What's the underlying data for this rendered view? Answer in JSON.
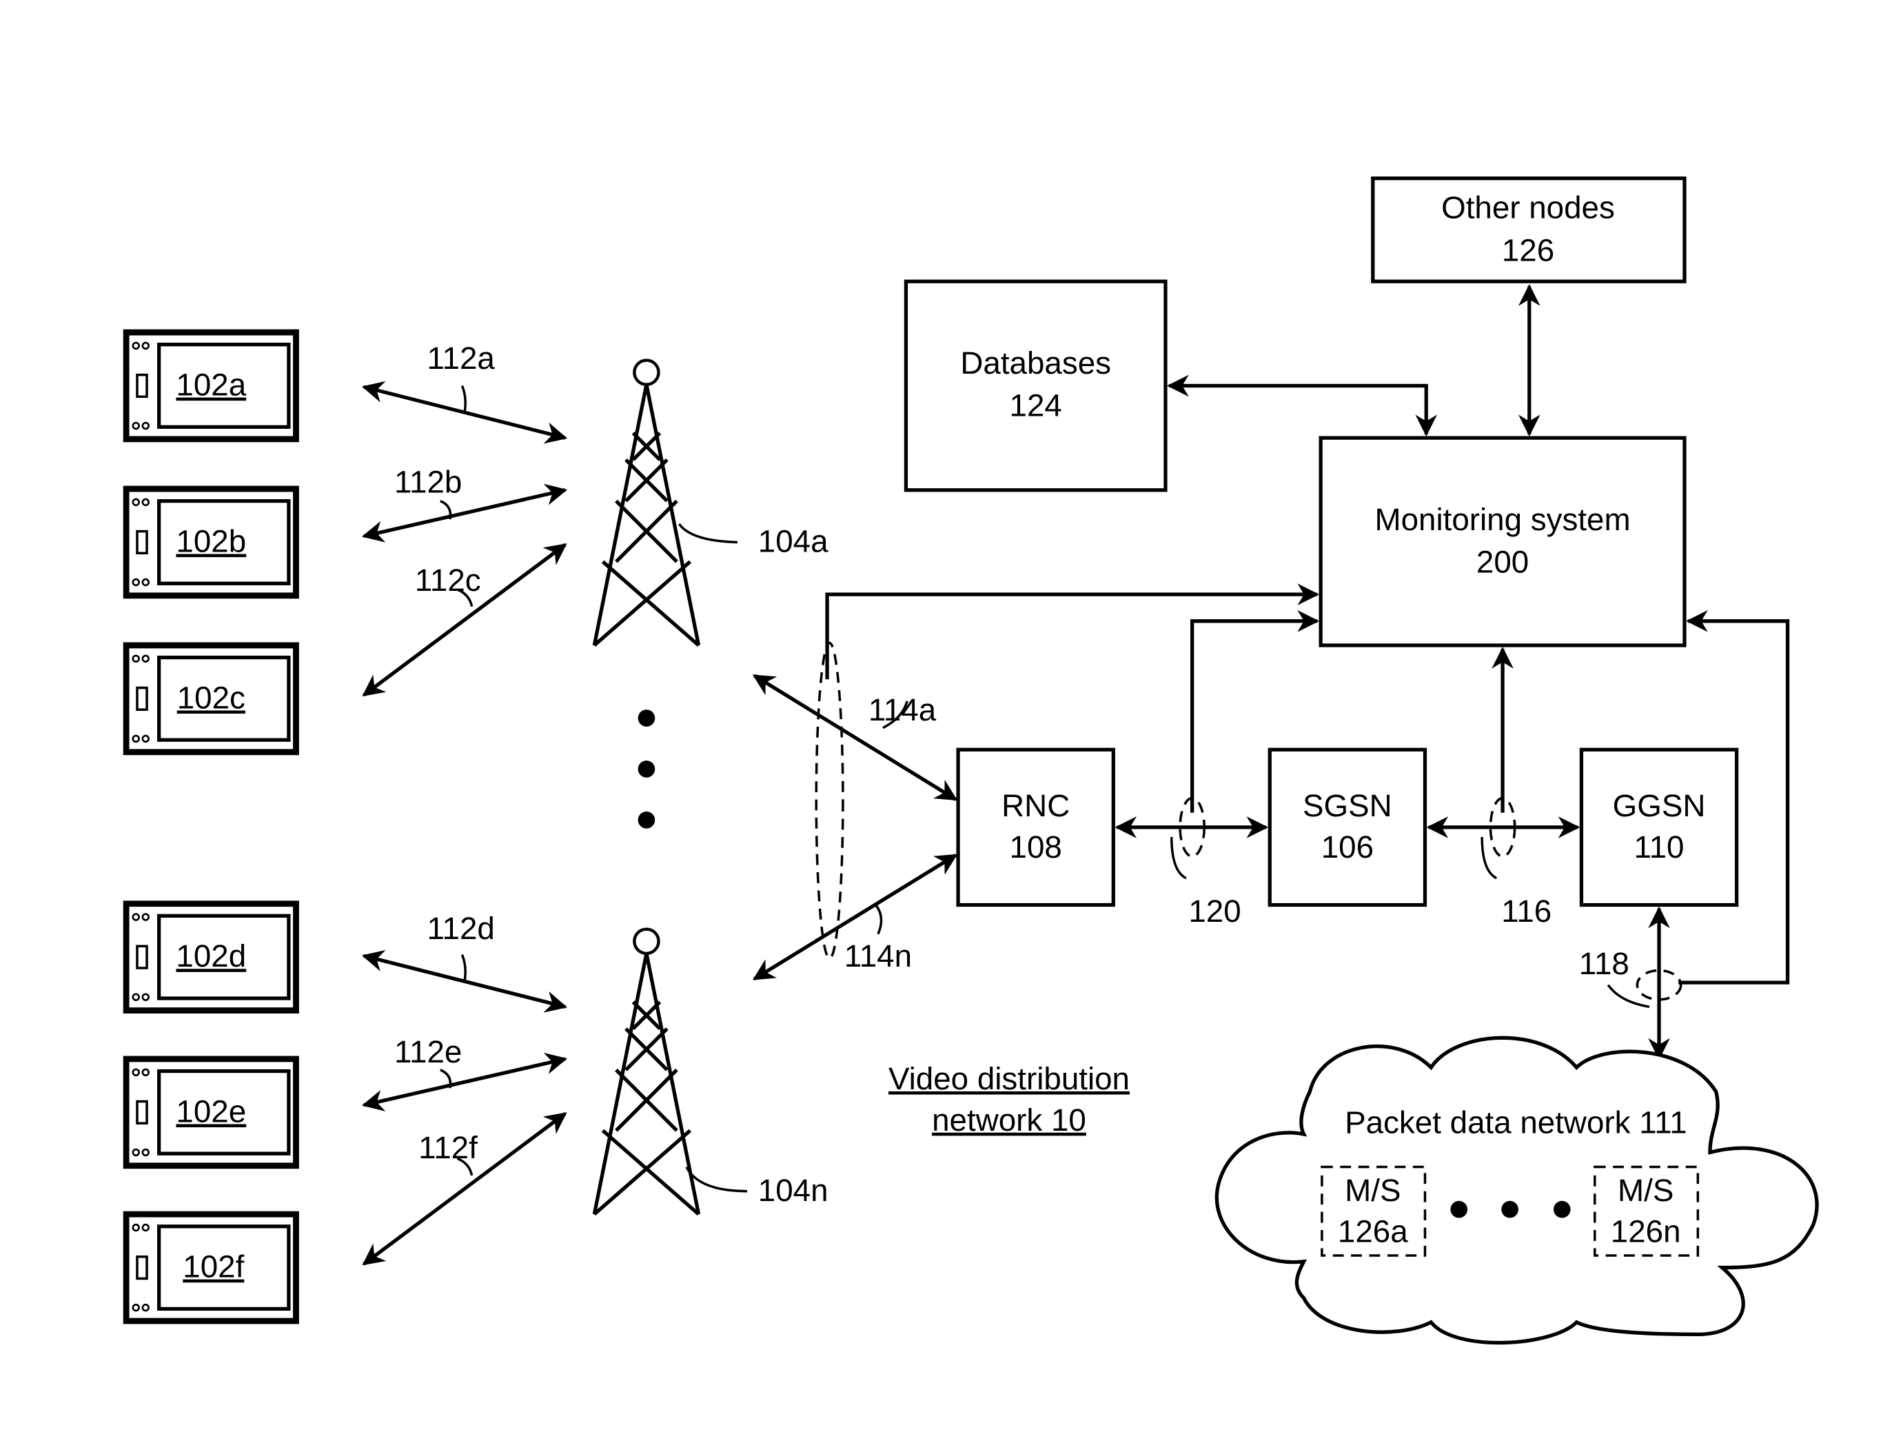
{
  "diagram": {
    "network_label": "Video distribution network 10",
    "devices": [
      {
        "id": "102a",
        "label": "102a",
        "link": "112a"
      },
      {
        "id": "102b",
        "label": "102b",
        "link": "112b"
      },
      {
        "id": "102c",
        "label": "102c",
        "link": "112c"
      },
      {
        "id": "102d",
        "label": "102d",
        "link": "112d"
      },
      {
        "id": "102e",
        "label": "102e",
        "link": "112e"
      },
      {
        "id": "102f",
        "label": "102f",
        "link": "112f"
      }
    ],
    "towers": [
      {
        "id": "104a",
        "label": "104a",
        "backhaul": "114a"
      },
      {
        "id": "104n",
        "label": "104n",
        "backhaul": "114n"
      }
    ],
    "nodes": {
      "rnc": {
        "name": "RNC",
        "num": "108"
      },
      "sgsn": {
        "name": "SGSN",
        "num": "106"
      },
      "ggsn": {
        "name": "GGSN",
        "num": "110"
      },
      "monitoring": {
        "name": "Monitoring system",
        "num": "200"
      },
      "databases": {
        "name": "Databases",
        "num": "124"
      },
      "other": {
        "name": "Other nodes",
        "num": "126"
      }
    },
    "taps": {
      "rnc_sgsn": "120",
      "sgsn_ggsn": "116",
      "ggsn_pdn": "118"
    },
    "pdn": {
      "label": "Packet data network 111",
      "servers": [
        {
          "line1": "M/S",
          "line2": "126a"
        },
        {
          "line1": "M/S",
          "line2": "126n"
        }
      ]
    }
  }
}
